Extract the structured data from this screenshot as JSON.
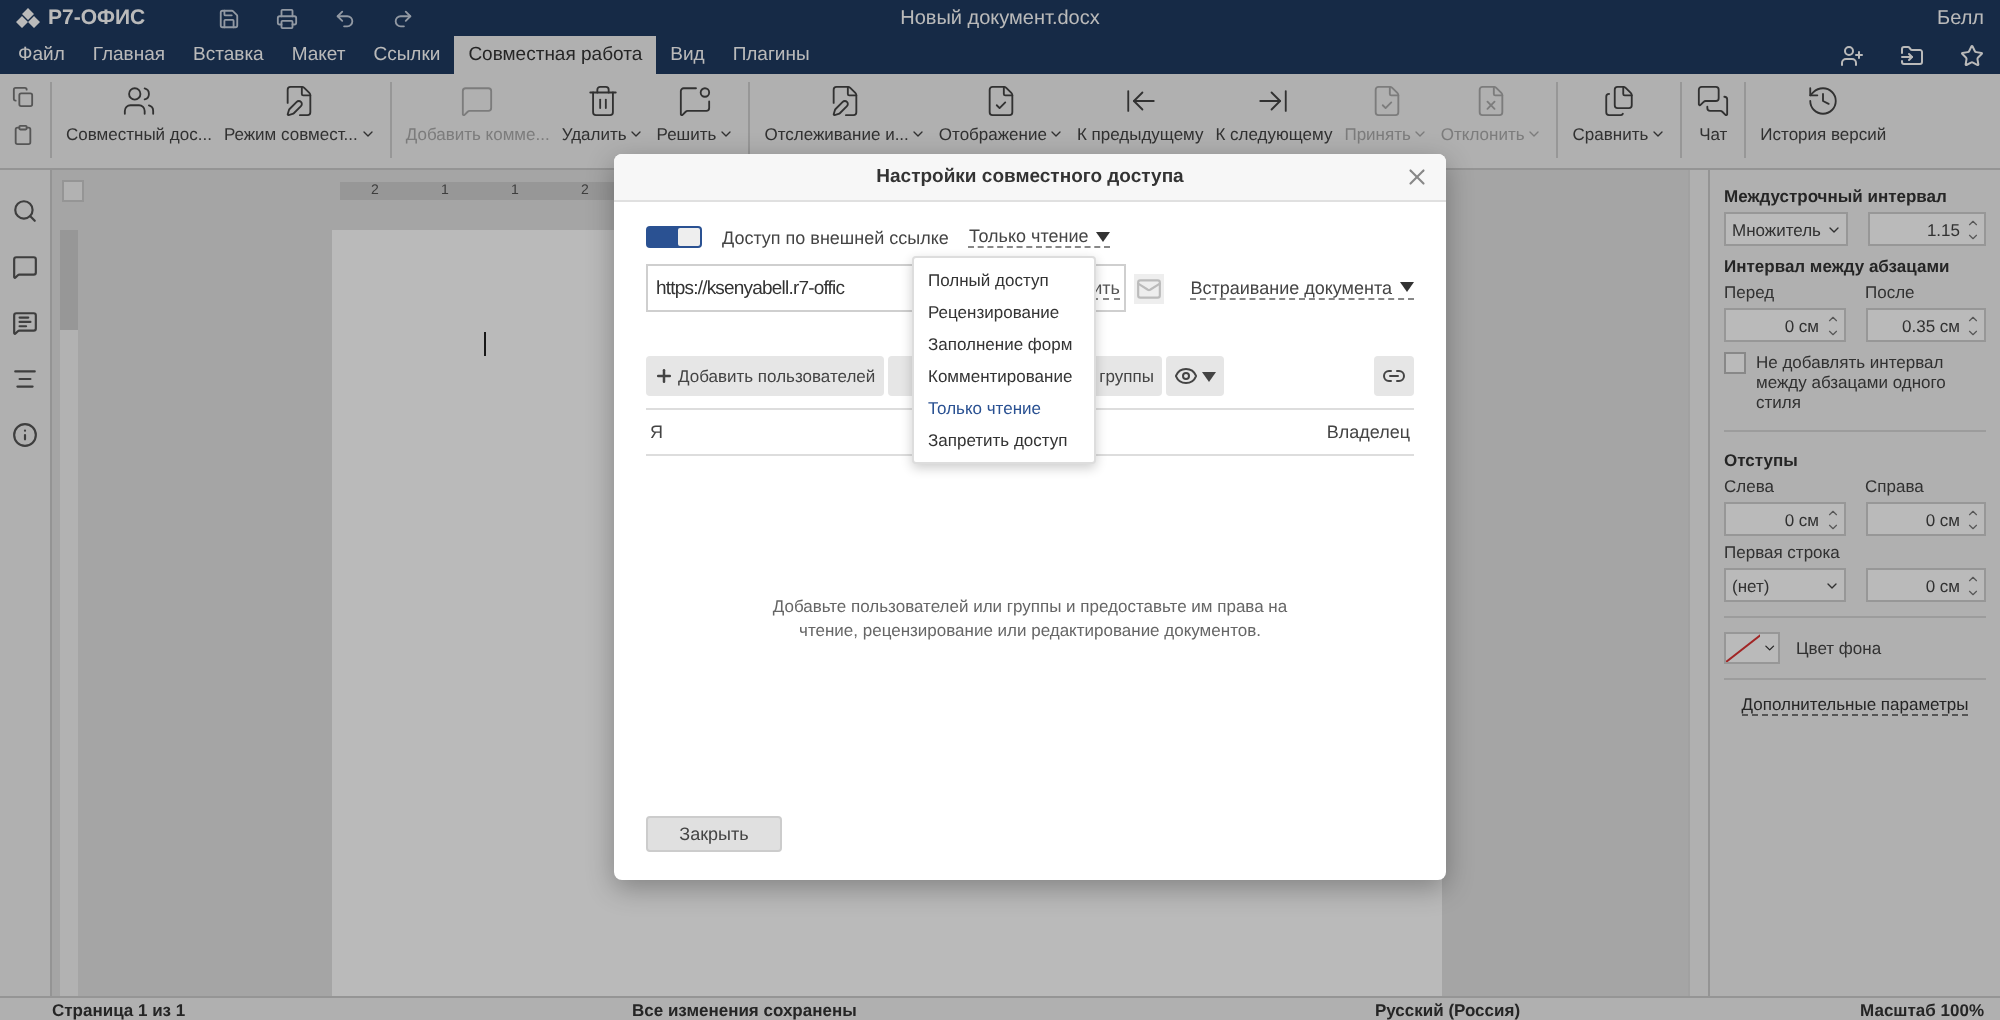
{
  "app": {
    "logo": "Р7-ОФИС",
    "document_title": "Новый документ.docx",
    "user": "Белл"
  },
  "menu_tabs": [
    {
      "label": "Файл",
      "selected": false
    },
    {
      "label": "Главная",
      "selected": false
    },
    {
      "label": "Вставка",
      "selected": false
    },
    {
      "label": "Макет",
      "selected": false
    },
    {
      "label": "Ссылки",
      "selected": false
    },
    {
      "label": "Совместная работа",
      "selected": true
    },
    {
      "label": "Вид",
      "selected": false
    },
    {
      "label": "Плагины",
      "selected": false
    }
  ],
  "toolbar": [
    {
      "kind": "users",
      "label": "Совместный дос...",
      "disabled": false,
      "dropdown": false
    },
    {
      "kind": "mode",
      "label": "Режим совмест...",
      "disabled": false,
      "dropdown": true
    },
    {
      "kind": "comment",
      "label": "Добавить комме...",
      "disabled": true,
      "dropdown": false
    },
    {
      "kind": "delete",
      "label": "Удалить",
      "disabled": false,
      "dropdown": true
    },
    {
      "kind": "resolve",
      "label": "Решить",
      "disabled": false,
      "dropdown": true
    },
    {
      "kind": "track",
      "label": "Отслеживание и...",
      "disabled": false,
      "dropdown": true
    },
    {
      "kind": "display",
      "label": "Отображение",
      "disabled": false,
      "dropdown": true
    },
    {
      "kind": "prev",
      "label": "К предыдущему",
      "disabled": false,
      "dropdown": false
    },
    {
      "kind": "next",
      "label": "К следующему",
      "disabled": false,
      "dropdown": false
    },
    {
      "kind": "accept",
      "label": "Принять",
      "disabled": true,
      "dropdown": true
    },
    {
      "kind": "reject",
      "label": "Отклонить",
      "disabled": true,
      "dropdown": true
    },
    {
      "kind": "compare",
      "label": "Сравнить",
      "disabled": false,
      "dropdown": true
    },
    {
      "kind": "chat",
      "label": "Чат",
      "disabled": false,
      "dropdown": false
    },
    {
      "kind": "history",
      "label": "История версий",
      "disabled": false,
      "dropdown": false
    }
  ],
  "ruler_labels": [
    "2",
    "1",
    "1",
    "2"
  ],
  "right_panel": {
    "line_spacing": {
      "title": "Междустрочный интервал",
      "mode": "Множитель",
      "value": "1.15"
    },
    "paragraph_spacing": {
      "title": "Интервал между абзацами",
      "before_label": "Перед",
      "before": "0 см",
      "after_label": "После",
      "after": "0.35 см"
    },
    "no_interval": {
      "label": "Не добавлять интервал между абзацами одного стиля",
      "checked": false
    },
    "indents": {
      "title": "Отступы",
      "left_label": "Слева",
      "left": "0 см",
      "right_label": "Справа",
      "right": "0 см",
      "first_line_label": "Первая строка",
      "first_line_mode": "(нет)",
      "first_line": "0 см"
    },
    "background_label": "Цвет фона",
    "advanced_link": "Дополнительные параметры"
  },
  "status_bar": {
    "page": "Страница 1 из 1",
    "saved": "Все изменения сохранены",
    "language": "Русский (Россия)",
    "zoom": "Масштаб 100%"
  },
  "dialog": {
    "title": "Настройки совместного доступа",
    "external_link": {
      "on": true,
      "label": "Доступ по внешней ссылке",
      "access": "Только чтение"
    },
    "url": "https://ksenyabell.r7-offic",
    "copy_tail": "ить",
    "embed": "Встраивание документа",
    "add_users": "Добавить пользователей",
    "add_groups_tail": "группы",
    "users": [
      {
        "name": "Я",
        "role": "Владелец"
      }
    ],
    "empty_message": "Добавьте пользователей или группы и предоставьте им права на чтение, рецензирование или редактирование документов.",
    "close": "Закрыть",
    "access_menu": [
      {
        "label": "Полный доступ",
        "selected": false
      },
      {
        "label": "Рецензирование",
        "selected": false
      },
      {
        "label": "Заполнение форм",
        "selected": false
      },
      {
        "label": "Комментирование",
        "selected": false
      },
      {
        "label": "Только чтение",
        "selected": true
      },
      {
        "label": "Запретить доступ",
        "selected": false
      }
    ]
  }
}
